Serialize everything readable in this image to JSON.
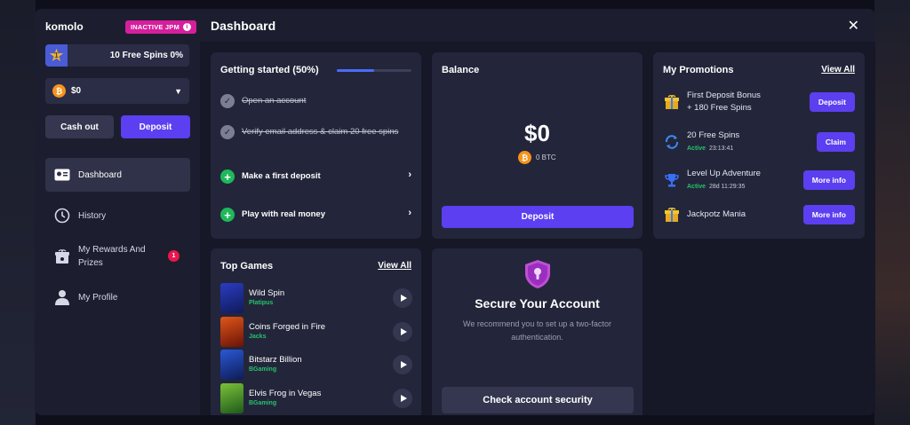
{
  "brand": "komolo",
  "jpm_badge": "INACTIVE JPM",
  "level": {
    "number": "1",
    "label": "10 Free Spins 0%"
  },
  "wallet": {
    "amount": "$0",
    "currency_icon": "bitcoin-icon"
  },
  "sidebar_buttons": {
    "cashout": "Cash out",
    "deposit": "Deposit"
  },
  "nav": [
    {
      "label": "Dashboard",
      "icon": "dashboard-icon",
      "active": true
    },
    {
      "label": "History",
      "icon": "clock-icon"
    },
    {
      "label": "My Rewards And Prizes",
      "icon": "gift-box-icon",
      "badge": "1"
    },
    {
      "label": "My Profile",
      "icon": "user-icon"
    }
  ],
  "header": {
    "title": "Dashboard",
    "close": "✕"
  },
  "getting_started": {
    "title": "Getting started (50%)",
    "progress": 0.5,
    "items": [
      {
        "label": "Open an account",
        "done": true
      },
      {
        "label": "Verify email address & claim 20 free spins",
        "done": true
      },
      {
        "label": "Make a first deposit",
        "done": false
      },
      {
        "label": "Play with real money",
        "done": false
      }
    ]
  },
  "balance": {
    "title": "Balance",
    "amount": "$0",
    "btc": "0 BTC",
    "deposit": "Deposit"
  },
  "promotions": {
    "title": "My Promotions",
    "view_all": "View All",
    "items": [
      {
        "line1": "First Deposit Bonus",
        "line2": "+ 180 Free Spins",
        "button": "Deposit",
        "icon": "gift-icon"
      },
      {
        "line1": "20 Free Spins",
        "status": "Active",
        "time": "23:13:41",
        "button": "Claim",
        "icon": "refresh-icon"
      },
      {
        "line1": "Level Up Adventure",
        "status": "Active",
        "time": "28d 11:29:35",
        "button": "More info",
        "icon": "trophy-icon"
      },
      {
        "line1": "Jackpotz Mania",
        "button": "More info",
        "icon": "gift-icon"
      }
    ]
  },
  "top_games": {
    "title": "Top Games",
    "view_all": "View All",
    "items": [
      {
        "name": "Wild Spin",
        "provider": "Platipus",
        "color": "#1d2b8a"
      },
      {
        "name": "Coins Forged in Fire",
        "provider": "Jacks",
        "color": "#b8320f"
      },
      {
        "name": "Bitstarz Billion",
        "provider": "BGaming",
        "color": "#1a3a9a"
      },
      {
        "name": "Elvis Frog in Vegas",
        "provider": "BGaming",
        "color": "#2f7d2a"
      }
    ]
  },
  "secure": {
    "title": "Secure Your Account",
    "desc": "We recommend you to set up a two-factor authentication.",
    "button": "Check account security"
  }
}
